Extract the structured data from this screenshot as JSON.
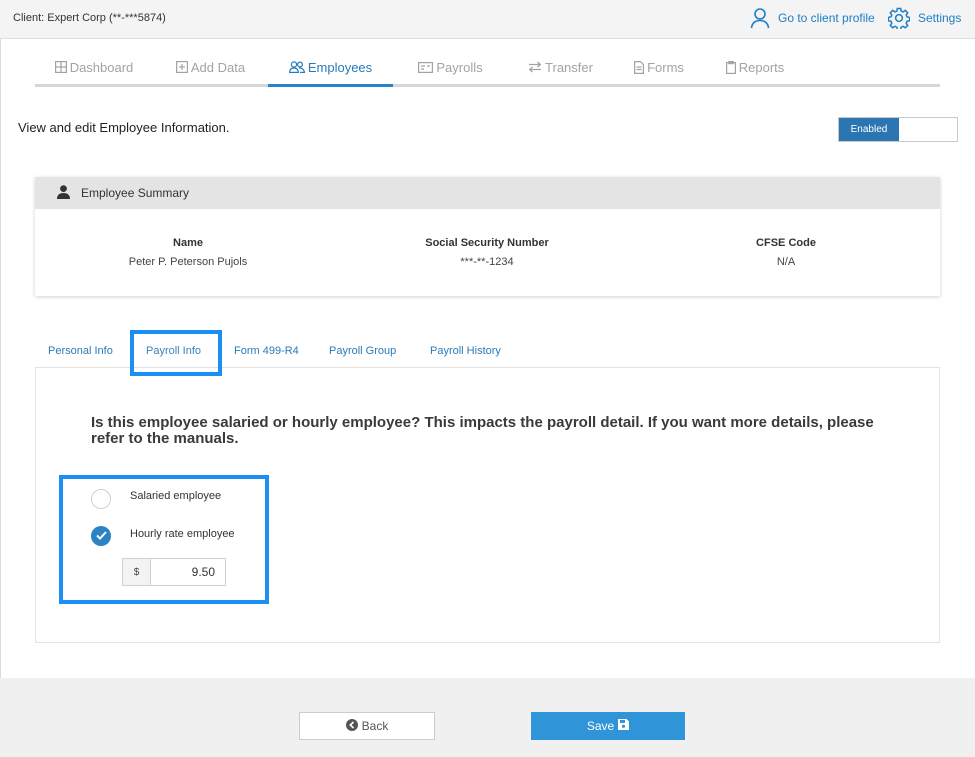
{
  "header": {
    "client_label": "Client: Expert Corp (**-***5874)",
    "profile_link": "Go to client profile",
    "settings_link": "Settings",
    "link_color": "#1d7ec4"
  },
  "nav": {
    "tabs": [
      {
        "label": "Dashboard",
        "icon": "grid-icon"
      },
      {
        "label": "Add Data",
        "icon": "plus-square-icon"
      },
      {
        "label": "Employees",
        "icon": "users-icon",
        "active": true
      },
      {
        "label": "Payrolls",
        "icon": "id-card-icon"
      },
      {
        "label": "Transfer",
        "icon": "transfer-arrows-icon"
      },
      {
        "label": "Forms",
        "icon": "document-icon"
      },
      {
        "label": "Reports",
        "icon": "clipboard-icon"
      }
    ],
    "active_color": "#2a7ab8"
  },
  "page": {
    "description": "View and edit Employee Information.",
    "toggle_label": "Enabled",
    "toggle_color": "#2b76b2"
  },
  "summary": {
    "title": "Employee Summary",
    "name_label": "Name",
    "name_value": "Peter P. Peterson Pujols",
    "ssn_label": "Social Security Number",
    "ssn_value": "***-**-1234",
    "cfse_label": "CFSE Code",
    "cfse_value": "N/A"
  },
  "subtabs": [
    {
      "label": "Personal Info"
    },
    {
      "label": "Payroll Info",
      "active": true
    },
    {
      "label": "Form 499-R4"
    },
    {
      "label": "Payroll Group"
    },
    {
      "label": "Payroll History"
    }
  ],
  "payroll_info": {
    "question": "Is this employee salaried or hourly employee? This impacts the payroll detail. If you want more details, please refer to the manuals.",
    "options": [
      {
        "label": "Salaried employee",
        "selected": false
      },
      {
        "label": "Hourly rate employee",
        "selected": true
      }
    ],
    "currency_symbol": "$",
    "hourly_rate": "9.50"
  },
  "footer": {
    "back_label": "Back",
    "save_label": "Save",
    "save_color": "#2f95d8"
  },
  "highlight_color": "#1e8ff2"
}
